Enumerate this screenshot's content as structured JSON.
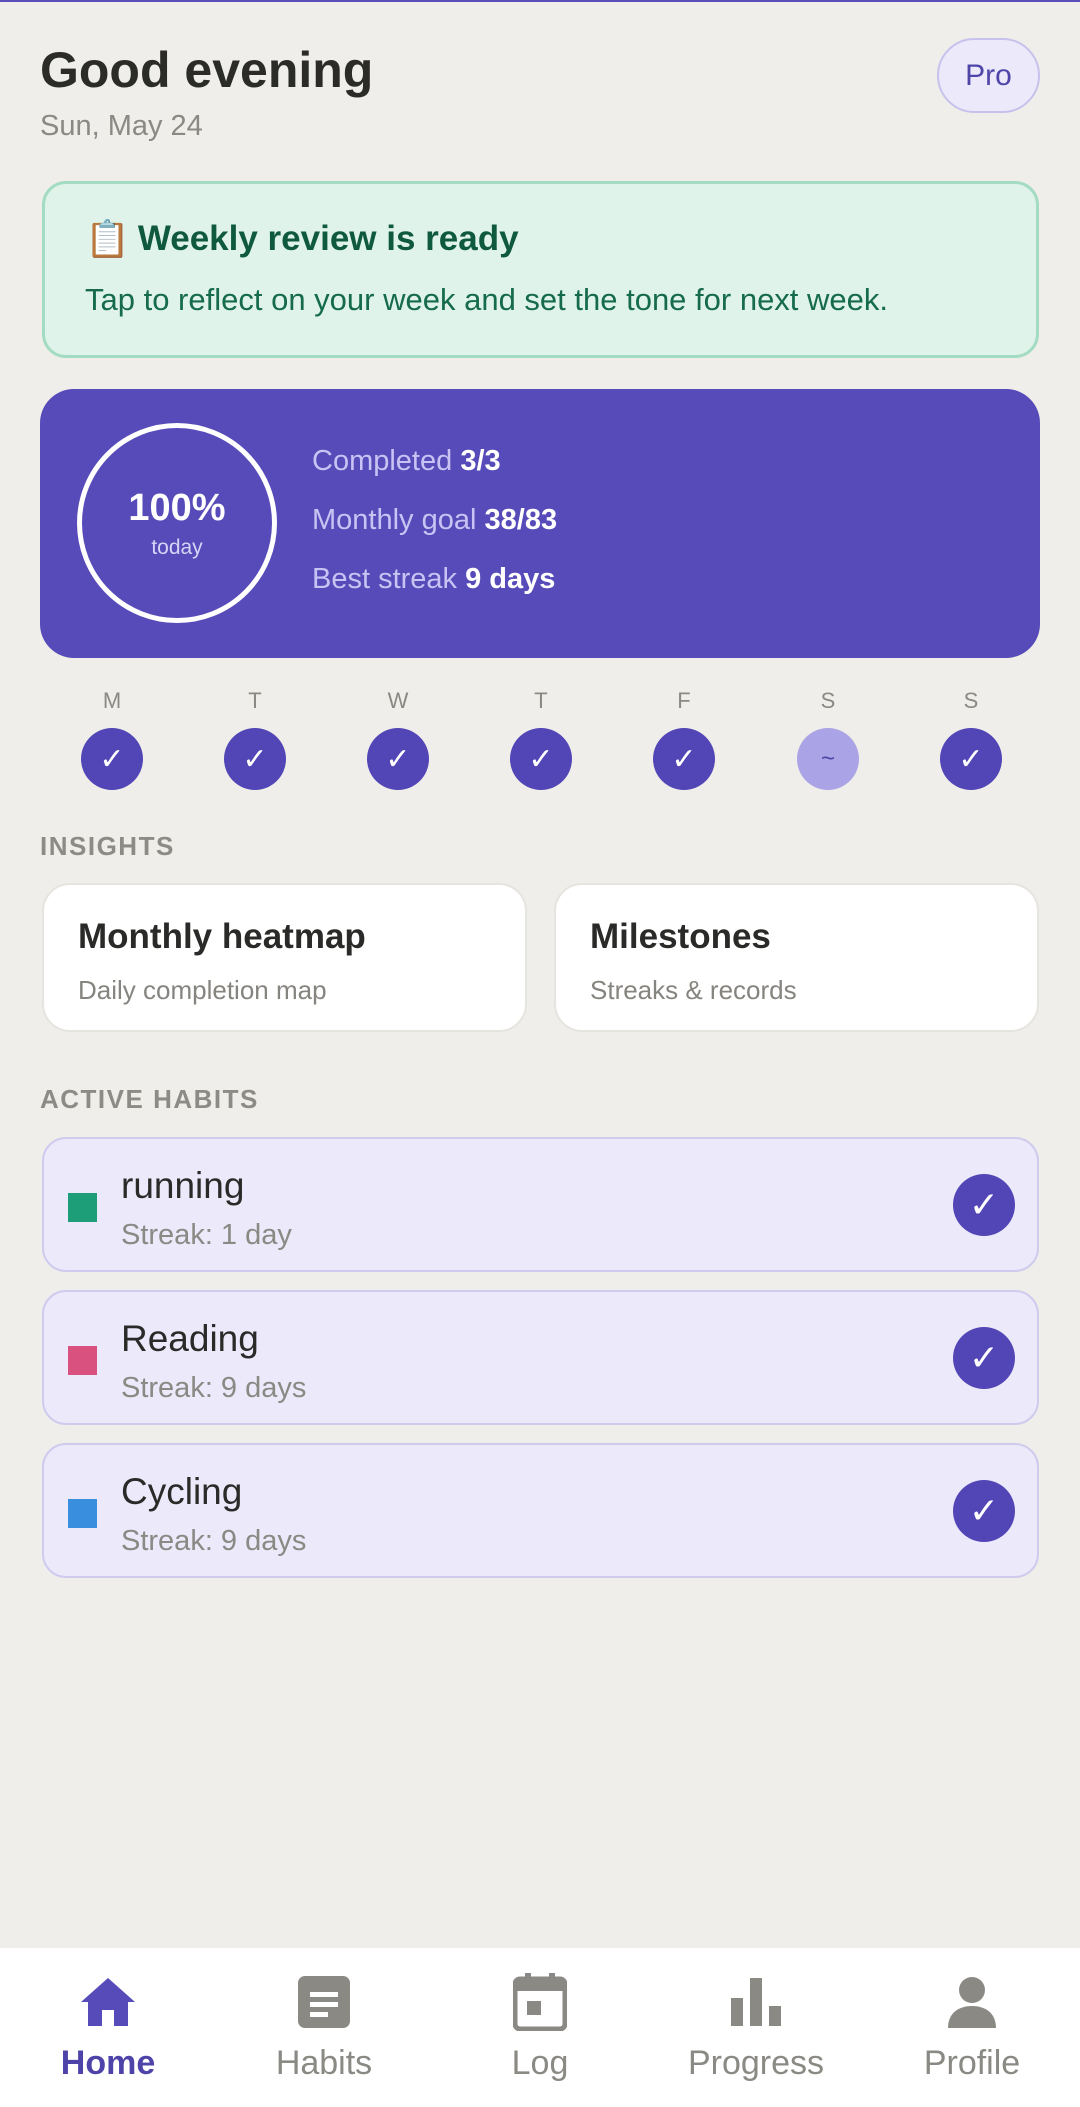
{
  "header": {
    "greeting": "Good evening",
    "date": "Sun, May 24",
    "badge": "Pro"
  },
  "review": {
    "icon": "clipboard-icon",
    "emoji": "📋",
    "title": "Weekly review is ready",
    "description": "Tap to reflect on your week and set the tone for next week."
  },
  "summary": {
    "percent": "100%",
    "percent_label": "today",
    "completed_label": "Completed",
    "completed_value": "3/3",
    "monthly_label": "Monthly goal",
    "monthly_value": "38/83",
    "streak_label": "Best streak",
    "streak_value": "9 days"
  },
  "week": [
    {
      "letter": "M",
      "mark": "✓",
      "state": "done"
    },
    {
      "letter": "T",
      "mark": "✓",
      "state": "done"
    },
    {
      "letter": "W",
      "mark": "✓",
      "state": "done"
    },
    {
      "letter": "T",
      "mark": "✓",
      "state": "done"
    },
    {
      "letter": "F",
      "mark": "✓",
      "state": "done"
    },
    {
      "letter": "S",
      "mark": "~",
      "state": "partial"
    },
    {
      "letter": "S",
      "mark": "✓",
      "state": "done"
    }
  ],
  "insights": {
    "heading": "INSIGHTS",
    "cards": [
      {
        "title": "Monthly heatmap",
        "subtitle": "Daily completion map"
      },
      {
        "title": "Milestones",
        "subtitle": "Streaks & records"
      }
    ]
  },
  "habits": {
    "heading": "ACTIVE HABITS",
    "items": [
      {
        "name": "running",
        "streak": "Streak: 1 day",
        "color": "#1e9e78",
        "check": "✓"
      },
      {
        "name": "Reading",
        "streak": "Streak: 9 days",
        "color": "#d9527f",
        "check": "✓"
      },
      {
        "name": "Cycling",
        "streak": "Streak: 9 days",
        "color": "#3a8ede",
        "check": "✓"
      }
    ]
  },
  "nav": {
    "items": [
      {
        "label": "Home",
        "icon": "home-icon",
        "active": true
      },
      {
        "label": "Habits",
        "icon": "list-icon",
        "active": false
      },
      {
        "label": "Log",
        "icon": "calendar-icon",
        "active": false
      },
      {
        "label": "Progress",
        "icon": "bar-chart-icon",
        "active": false
      },
      {
        "label": "Profile",
        "icon": "person-icon",
        "active": false
      }
    ]
  },
  "colors": {
    "accent": "#564bb9",
    "background": "#f0eeea",
    "review_bg": "#e0f3ea",
    "habit_bg": "#ebe9fa"
  }
}
